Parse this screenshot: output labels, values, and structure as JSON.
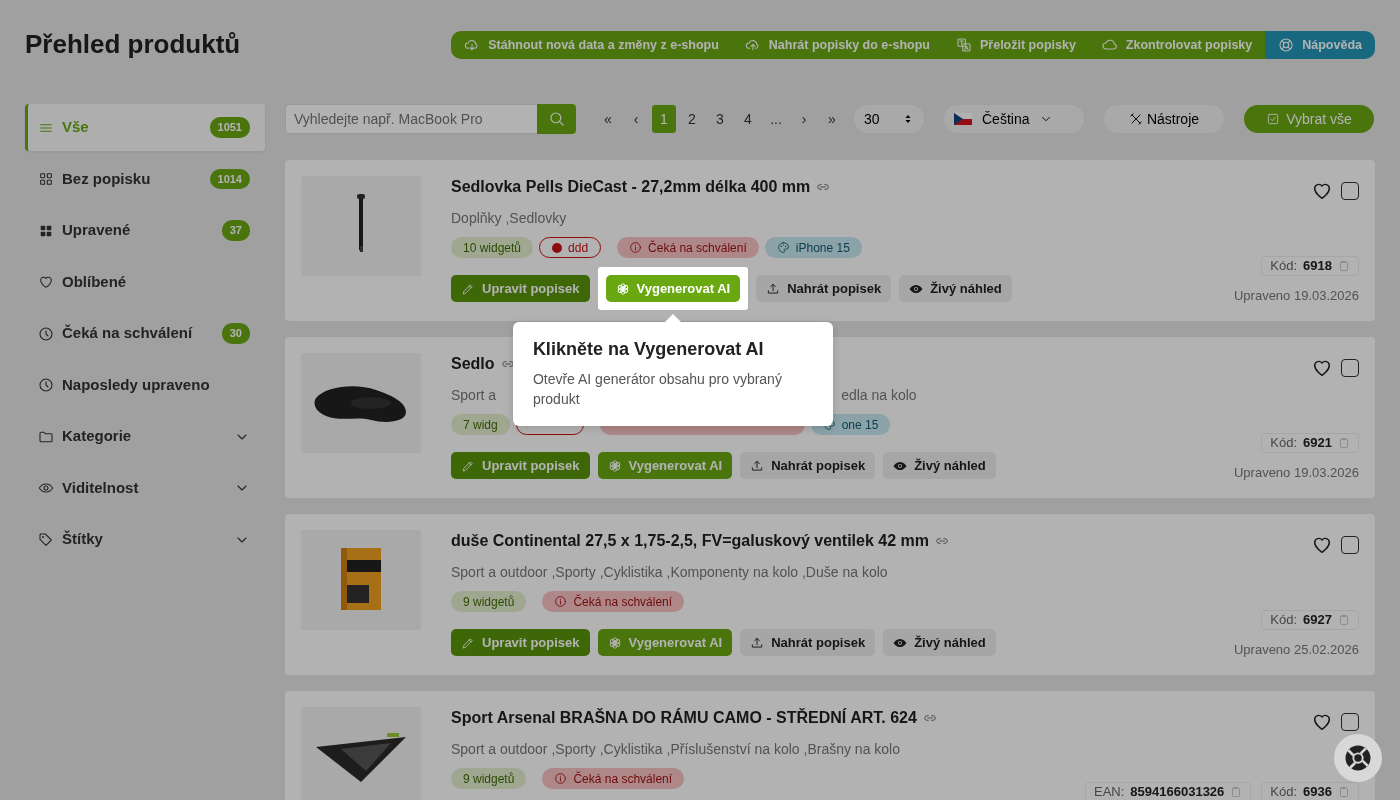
{
  "title": "Přehled produktů",
  "toolbar": [
    {
      "kind": "download",
      "label": "Stáhnout nová data a změny z e-shopu"
    },
    {
      "kind": "upload",
      "label": "Nahrát popisky do e-shopu"
    },
    {
      "kind": "translate",
      "label": "Přeložit popisky"
    },
    {
      "kind": "check",
      "label": "Zkontrolovat popisky"
    },
    {
      "kind": "help",
      "label": "Nápověda"
    }
  ],
  "sidebar": [
    {
      "kind": "filter",
      "label": "Vše",
      "count": "1051",
      "selected": true
    },
    {
      "kind": "filter",
      "label": "Bez popisku",
      "count": "1014",
      "selected": false
    },
    {
      "kind": "filter",
      "label": "Upravené",
      "count": "37",
      "selected": false
    },
    {
      "kind": "filter",
      "label": "Oblíbené",
      "selected": false
    },
    {
      "kind": "filter",
      "label": "Čeká na schválení",
      "count": "30",
      "selected": false
    },
    {
      "kind": "filter",
      "label": "Naposledy upraveno",
      "selected": false
    },
    {
      "kind": "group",
      "label": "Kategorie",
      "expanded": false
    },
    {
      "kind": "group",
      "label": "Viditelnost",
      "expanded": false
    },
    {
      "kind": "group",
      "label": "Štítky",
      "expanded": false
    }
  ],
  "search": {
    "placeholder": "Vyhledejte např. MacBook Pro"
  },
  "pagination": [
    {
      "label": "«",
      "selected": false
    },
    {
      "label": "‹",
      "selected": false
    },
    {
      "label": "1",
      "selected": true
    },
    {
      "label": "2",
      "selected": false
    },
    {
      "label": "3",
      "selected": false
    },
    {
      "label": "4",
      "selected": false
    },
    {
      "label": "...",
      "selected": false
    },
    {
      "label": "›",
      "selected": false
    },
    {
      "label": "»",
      "selected": false
    }
  ],
  "per_page": "30",
  "language": "Čeština",
  "tools_button": "Nástroje",
  "select_all_button": "Vybrat vše",
  "products": [
    {
      "title": "Sedlovka Pells DieCast - 27,2mm délka 400 mm",
      "category": [
        "Doplňky ,Sedlovky"
      ],
      "tags": [
        {
          "kind": "count",
          "label": "10 widgetů"
        },
        {
          "kind": "label",
          "label": "ddd"
        },
        {
          "kind": "status",
          "label": "Čeká na schválení"
        },
        {
          "kind": "device",
          "label": "iPhone 15"
        }
      ],
      "buttons": [
        {
          "kind": "edit",
          "label": "Upravit popisek",
          "highlighted": false
        },
        {
          "kind": "generate",
          "label": "Vygenerovat AI",
          "highlighted": true
        },
        {
          "kind": "upload",
          "label": "Nahrát popisek",
          "highlighted": false
        },
        {
          "kind": "preview",
          "label": "Živý náhled",
          "highlighted": false
        }
      ],
      "codes": [
        {
          "label": "Kód:",
          "value": "6918"
        }
      ],
      "updated": "Upraveno 19.03.2026",
      "favorite": false,
      "checked": false
    },
    {
      "title": "Sedlo",
      "category": [
        "Sport a",
        "edla na kolo"
      ],
      "tags": [
        {
          "kind": "count",
          "label": "7 widg"
        },
        {
          "kind": "label"
        },
        {
          "kind": "status"
        },
        {
          "kind": "device",
          "label": "one 15"
        }
      ],
      "buttons": [
        {
          "kind": "edit",
          "label": "Upravit popisek",
          "highlighted": false
        },
        {
          "kind": "generate",
          "label": "Vygenerovat AI",
          "highlighted": false
        },
        {
          "kind": "upload",
          "label": "Nahrát popisek",
          "highlighted": false
        },
        {
          "kind": "preview",
          "label": "Živý náhled",
          "highlighted": false
        }
      ],
      "codes": [
        {
          "label": "Kód:",
          "value": "6921"
        }
      ],
      "updated": "Upraveno 19.03.2026",
      "favorite": false,
      "checked": false
    },
    {
      "title": "duše Continental 27,5 x 1,75-2,5, FV=galuskový ventilek 42 mm",
      "category": [
        "Sport a outdoor ,Sporty ,Cyklistika ,Komponenty na kolo ,Duše na kolo"
      ],
      "tags": [
        {
          "kind": "count",
          "label": "9 widgetů"
        },
        {
          "kind": "status",
          "label": "Čeká na schválení"
        }
      ],
      "buttons": [
        {
          "kind": "edit",
          "label": "Upravit popisek",
          "highlighted": false
        },
        {
          "kind": "generate",
          "label": "Vygenerovat AI",
          "highlighted": false
        },
        {
          "kind": "upload",
          "label": "Nahrát popisek",
          "highlighted": false
        },
        {
          "kind": "preview",
          "label": "Živý náhled",
          "highlighted": false
        }
      ],
      "codes": [
        {
          "label": "Kód:",
          "value": "6927"
        }
      ],
      "updated": "Upraveno 25.02.2026",
      "favorite": false,
      "checked": false
    },
    {
      "title": "Sport Arsenal BRAŠNA DO RÁMU CAMO - STŘEDNÍ ART. 624",
      "category": [
        "Sport a outdoor ,Sporty ,Cyklistika ,Příslušenství na kolo ,Brašny na kolo"
      ],
      "tags": [
        {
          "kind": "count",
          "label": "9 widgetů"
        },
        {
          "kind": "status",
          "label": "Čeká na schválení"
        }
      ],
      "codes": [
        {
          "label": "EAN:",
          "value": "8594166031326"
        },
        {
          "label": "Kód:",
          "value": "6936"
        }
      ],
      "favorite": false,
      "checked": false
    }
  ],
  "tour": {
    "title": "Klikněte na Vygenerovat AI",
    "text": "Otevře AI generátor obsahu pro vybraný produkt"
  }
}
